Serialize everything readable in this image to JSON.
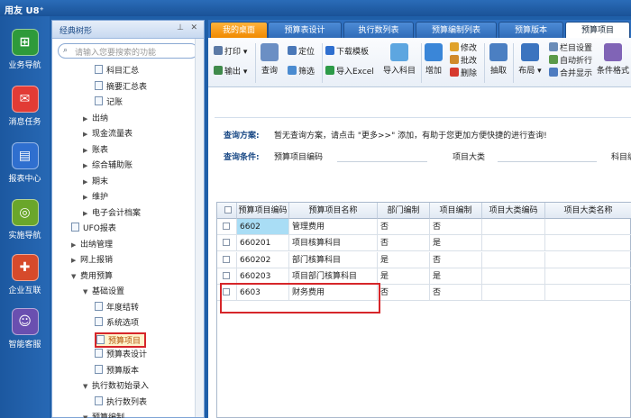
{
  "app": {
    "title": "用友 U8⁺"
  },
  "rail": [
    {
      "label": "业务导航",
      "icon": "business-nav-icon",
      "color": "#2e9a3a",
      "glyph": "⊞"
    },
    {
      "label": "消息任务",
      "icon": "message-icon",
      "color": "#e23b35",
      "glyph": "✉"
    },
    {
      "label": "报表中心",
      "icon": "report-icon",
      "color": "#2f6fcf",
      "glyph": "▤"
    },
    {
      "label": "实施导航",
      "icon": "compass-icon",
      "color": "#6aa62b",
      "glyph": "◎"
    },
    {
      "label": "企业互联",
      "icon": "connect-icon",
      "color": "#d64a2b",
      "glyph": "✚"
    },
    {
      "label": "智能客服",
      "icon": "support-icon",
      "color": "#6a4fb0",
      "glyph": "☺"
    }
  ],
  "tree": {
    "title": "经典树形",
    "search_placeholder": "请输入您要搜索的功能",
    "nodes": [
      {
        "label": "科目汇总",
        "type": "doc",
        "indent": 3
      },
      {
        "label": "摘要汇总表",
        "type": "doc",
        "indent": 3
      },
      {
        "label": "记账",
        "type": "doc",
        "indent": 3
      },
      {
        "label": "出纳",
        "type": "collapsed",
        "indent": 2
      },
      {
        "label": "现金流量表",
        "type": "collapsed",
        "indent": 2
      },
      {
        "label": "账表",
        "type": "collapsed",
        "indent": 2
      },
      {
        "label": "综合辅助账",
        "type": "collapsed",
        "indent": 2
      },
      {
        "label": "期末",
        "type": "collapsed",
        "indent": 2
      },
      {
        "label": "维护",
        "type": "collapsed",
        "indent": 2
      },
      {
        "label": "电子会计档案",
        "type": "collapsed",
        "indent": 2
      },
      {
        "label": "UFO报表",
        "type": "doc",
        "indent": 1
      },
      {
        "label": "出纳管理",
        "type": "collapsed",
        "indent": 1
      },
      {
        "label": "网上报销",
        "type": "collapsed",
        "indent": 1
      },
      {
        "label": "费用预算",
        "type": "expanded",
        "indent": 1
      },
      {
        "label": "基础设置",
        "type": "expanded",
        "indent": 2
      },
      {
        "label": "年度结转",
        "type": "doc",
        "indent": 3
      },
      {
        "label": "系统选项",
        "type": "doc",
        "indent": 3
      },
      {
        "label": "预算项目",
        "type": "doc",
        "indent": 3,
        "selected": true
      },
      {
        "label": "预算表设计",
        "type": "doc",
        "indent": 3
      },
      {
        "label": "预算版本",
        "type": "doc",
        "indent": 3
      },
      {
        "label": "执行数初始录入",
        "type": "expanded",
        "indent": 2
      },
      {
        "label": "执行数列表",
        "type": "doc",
        "indent": 3
      },
      {
        "label": "预算编制",
        "type": "expanded",
        "indent": 2
      }
    ]
  },
  "tabs": [
    {
      "label": "我的桌面",
      "kind": "home"
    },
    {
      "label": "预算表设计"
    },
    {
      "label": "执行数列表"
    },
    {
      "label": "预算编制列表"
    },
    {
      "label": "预算版本"
    },
    {
      "label": "预算项目",
      "kind": "active"
    }
  ],
  "toolbar": {
    "print": "打印",
    "export": "输出",
    "query": "查询",
    "locate": "定位",
    "filter": "筛选",
    "download_template": "下载模板",
    "import_excel": "导入Excel",
    "import_subject": "导入科目",
    "add": "增加",
    "modify": "修改",
    "batch_modify": "批改",
    "delete": "删除",
    "extract": "抽取",
    "layout": "布局",
    "column_settings": "栏目设置",
    "auto_wrap": "自动折行",
    "merge_display": "合并显示",
    "conditional_format": "条件格式"
  },
  "query": {
    "plan_label": "查询方案:",
    "plan_text": "暂无查询方案，请点击 \"更多>>\" 添加，有助于您更加方便快捷的进行查询!",
    "cond_label": "查询条件:",
    "fields": [
      "预算项目编码",
      "项目大类",
      "科目编"
    ]
  },
  "grid": {
    "columns": [
      "预算项目编码",
      "预算项目名称",
      "部门编制",
      "项目编制",
      "项目大类编码",
      "项目大类名称"
    ],
    "rows": [
      {
        "code": "6602",
        "name": "管理费用",
        "dept": "否",
        "proj": "否"
      },
      {
        "code": "660201",
        "name": "项目核算科目",
        "dept": "否",
        "proj": "是"
      },
      {
        "code": "660202",
        "name": "部门核算科目",
        "dept": "是",
        "proj": "否"
      },
      {
        "code": "660203",
        "name": "项目部门核算科目",
        "dept": "是",
        "proj": "是"
      },
      {
        "code": "6603",
        "name": "财务费用",
        "dept": "否",
        "proj": "否"
      }
    ]
  }
}
